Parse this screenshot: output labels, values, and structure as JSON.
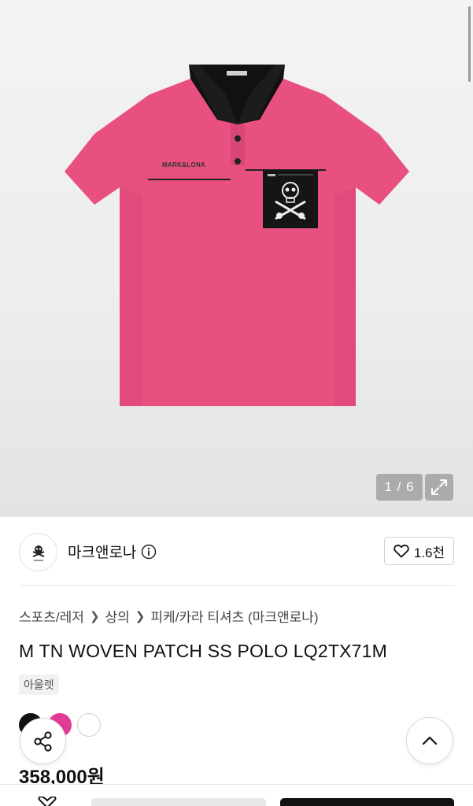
{
  "gallery": {
    "counter": "1 / 6",
    "collar_label": "",
    "chest_print": "MARK&LONA"
  },
  "brand": {
    "name": "마크앤로나",
    "logo_icon": "skull-crossbones-icon",
    "like_count": "1.6천"
  },
  "breadcrumb": [
    "스포츠/레저",
    "상의",
    "피케/카라 티셔츠 (마크앤로나)"
  ],
  "product": {
    "title": "M TN WOVEN PATCH SS POLO LQ2TX71M",
    "tag": "아울렛",
    "price": "358,000원"
  },
  "colors": {
    "swatches": [
      "#111111",
      "#e23b95",
      "#ffffff"
    ],
    "shirt": "#e8507f",
    "collar": "#111111"
  }
}
